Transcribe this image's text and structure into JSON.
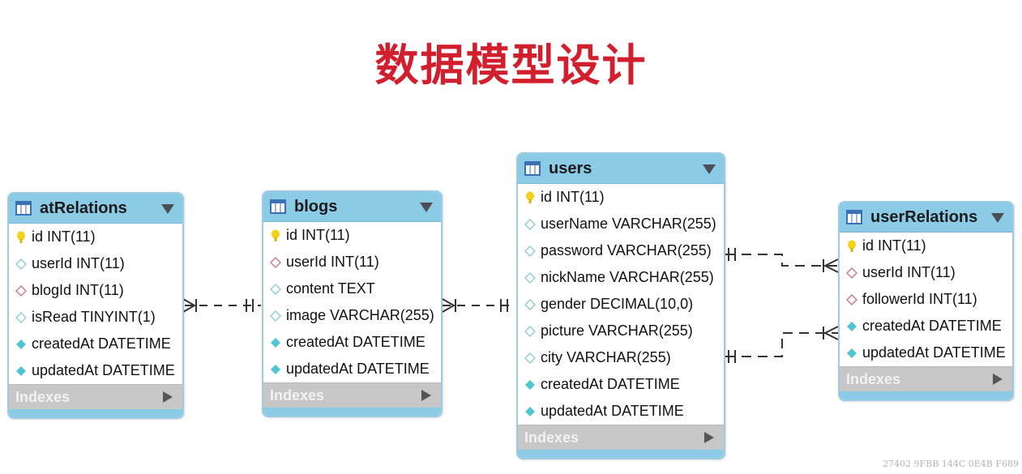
{
  "title": "数据模型设计",
  "tables": {
    "atRelations": {
      "name": "atRelations",
      "fields": [
        "id INT(11)",
        "userId INT(11)",
        "blogId INT(11)",
        "isRead TINYINT(1)",
        "createdAt DATETIME",
        "updatedAt DATETIME"
      ],
      "indexes": "Indexes"
    },
    "blogs": {
      "name": "blogs",
      "fields": [
        "id INT(11)",
        "userId INT(11)",
        "content TEXT",
        "image VARCHAR(255)",
        "createdAt DATETIME",
        "updatedAt DATETIME"
      ],
      "indexes": "Indexes"
    },
    "users": {
      "name": "users",
      "fields": [
        "id INT(11)",
        "userName VARCHAR(255)",
        "password VARCHAR(255)",
        "nickName VARCHAR(255)",
        "gender DECIMAL(10,0)",
        "picture VARCHAR(255)",
        "city VARCHAR(255)",
        "createdAt DATETIME",
        "updatedAt DATETIME"
      ],
      "indexes": "Indexes"
    },
    "userRelations": {
      "name": "userRelations",
      "fields": [
        "id INT(11)",
        "userId INT(11)",
        "followerId INT(11)",
        "createdAt DATETIME",
        "updatedAt DATETIME"
      ],
      "indexes": "Indexes"
    }
  },
  "watermark": "27402 9FBB 144C 0E4B F689",
  "colors": {
    "title": "#d21f2e",
    "header": "#8ccbe6",
    "key": "#f2d21b",
    "fk": "#c97d8a",
    "column": "#8fcfd2",
    "timestamp": "#4fc5d0"
  }
}
